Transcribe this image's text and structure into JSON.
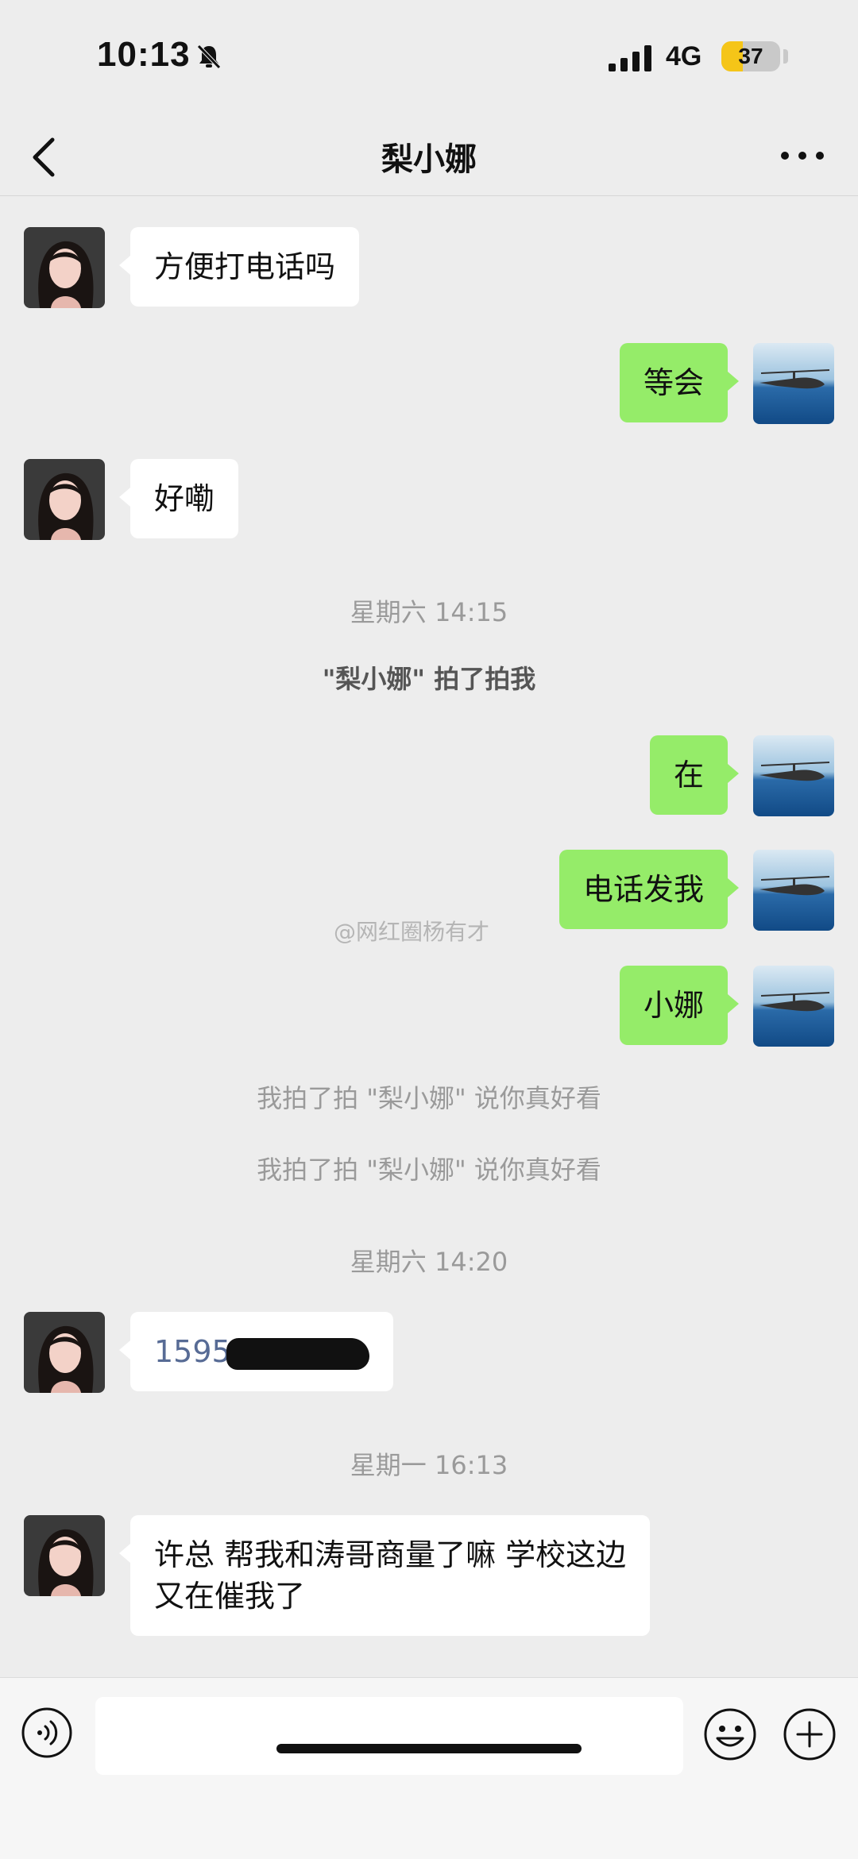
{
  "status_bar": {
    "time": "10:13",
    "network": "4G",
    "battery": "37",
    "battery_level": 0.37
  },
  "chat": {
    "title": "梨小娜"
  },
  "messages": {
    "m1": "方便打电话吗",
    "m2": "等会",
    "m3": "好嘞",
    "t1": "星期六 14:15",
    "s1": "\"梨小娜\" 拍了拍我",
    "m4": "在",
    "m5": "电话发我",
    "m6": "小娜",
    "s2": "我拍了拍 \"梨小娜\" 说你真好看",
    "s3": "我拍了拍 \"梨小娜\" 说你真好看",
    "t2": "星期六 14:20",
    "m7_visible": "1595",
    "t3": "星期一 16:13",
    "m8_line1": "许总 帮我和涛哥商量了嘛 学校这边",
    "m8_line2": "又在催我了"
  },
  "watermark": "@网红圈杨有才",
  "colors": {
    "outgoing_bubble": "#95ec69",
    "incoming_bubble": "#ffffff",
    "background": "#ededed",
    "link": "#576b95"
  },
  "icons": [
    "bell-slash-icon",
    "signal-icon",
    "battery-icon",
    "back-icon",
    "more-icon",
    "voice-icon",
    "emoji-icon",
    "plus-icon"
  ]
}
